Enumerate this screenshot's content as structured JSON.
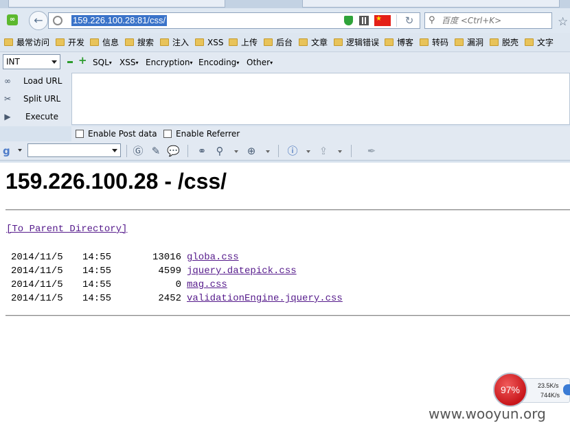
{
  "browser": {
    "url": "159.226.100.28:81/css/",
    "search_placeholder": "百度 <Ctrl+K>"
  },
  "bookmarks": [
    "最常访问",
    "开发",
    "信息",
    "搜索",
    "注入",
    "XSS",
    "上传",
    "后台",
    "文章",
    "逻辑错误",
    "博客",
    "转码",
    "漏洞",
    "脱壳",
    "文字"
  ],
  "hackbar": {
    "type_select": "INT",
    "menus": [
      "SQL",
      "XSS",
      "Encryption",
      "Encoding",
      "Other"
    ],
    "actions": {
      "load_url": "Load URL",
      "split_url": "Split URL",
      "execute": "Execute"
    },
    "enable_post": "Enable Post data",
    "enable_referrer": "Enable Referrer"
  },
  "page": {
    "title": "159.226.100.28 - /css/",
    "parent_link": "[To Parent Directory]",
    "files": [
      {
        "date": "2014/11/5",
        "time": "14:55",
        "size": "13016",
        "name": "globa.css"
      },
      {
        "date": "2014/11/5",
        "time": "14:55",
        "size": "4599",
        "name": "jquery.datepick.css"
      },
      {
        "date": "2014/11/5",
        "time": "14:55",
        "size": "0",
        "name": "mag.css"
      },
      {
        "date": "2014/11/5",
        "time": "14:55",
        "size": "2452",
        "name": "validationEngine.jquery.css"
      }
    ]
  },
  "speed_widget": {
    "percent": "97%",
    "upload": "23.5K/s",
    "download": "744K/s"
  },
  "watermark": "www.wooyun.org"
}
